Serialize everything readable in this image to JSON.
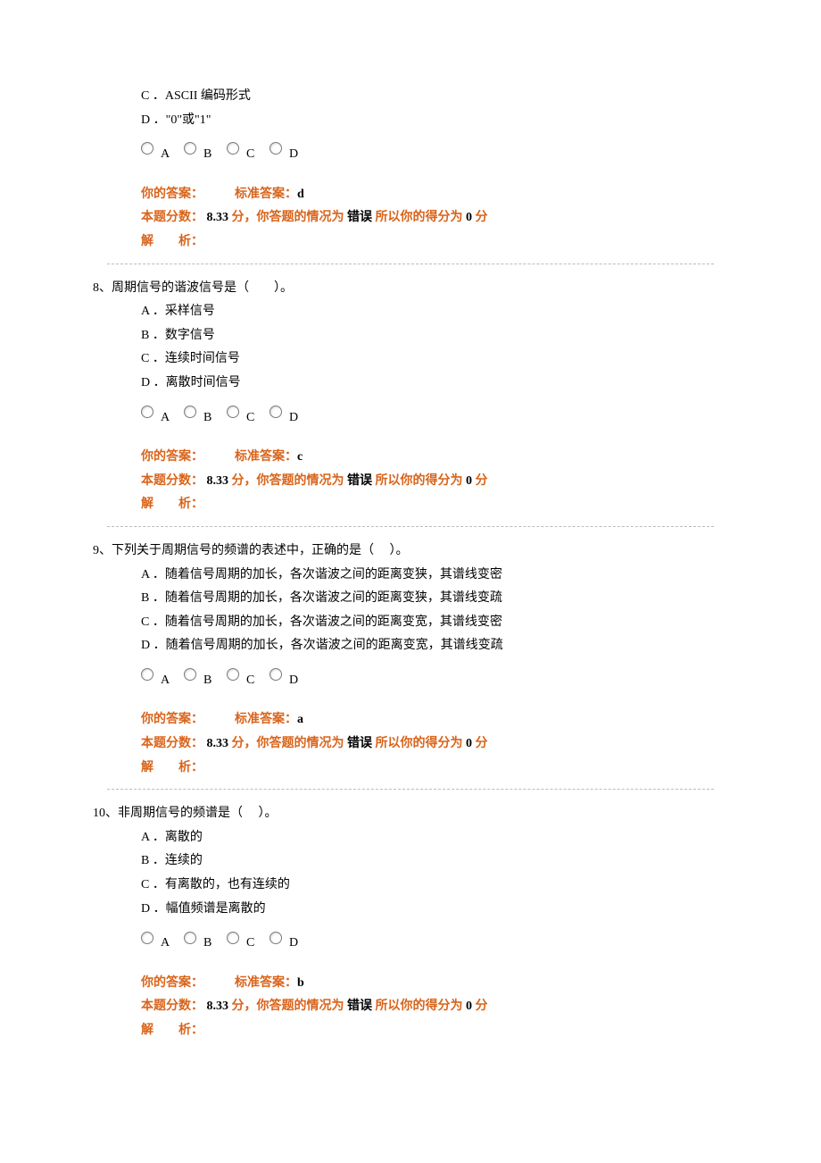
{
  "labels": {
    "your_answer_label": "你的答案：",
    "std_answer_label": "标准答案：",
    "score_prefix": "本题分数：",
    "score_unit": "分",
    "status_phrase_prefix": "，你答题的情况为",
    "so_score_prefix": "所以你的得分为",
    "explain_label": "解　　析："
  },
  "radio_letters": [
    "A",
    "B",
    "C",
    "D"
  ],
  "q7": {
    "options": [
      "C ．ASCII 编码形式",
      "D ．\"0\"或\"1\""
    ],
    "std_answer": "d",
    "score_value": "8.33",
    "status": "错误",
    "got": "0"
  },
  "q8": {
    "stem": "8、周期信号的谐波信号是（　　）。",
    "options": [
      "A ．采样信号",
      "B ．数字信号",
      "C ．连续时间信号",
      "D ．离散时间信号"
    ],
    "std_answer": "c",
    "score_value": "8.33",
    "status": "错误",
    "got": "0"
  },
  "q9": {
    "stem": "9、下列关于周期信号的频谱的表述中，正确的是（　 ）。",
    "options": [
      "A ．随着信号周期的加长，各次谐波之间的距离变狭，其谱线变密",
      "B ．随着信号周期的加长，各次谐波之间的距离变狭，其谱线变疏",
      "C ．随着信号周期的加长，各次谐波之间的距离变宽，其谱线变密",
      "D ．随着信号周期的加长，各次谐波之间的距离变宽，其谱线变疏"
    ],
    "std_answer": "a",
    "score_value": "8.33",
    "status": "错误",
    "got": "0"
  },
  "q10": {
    "stem": "10、非周期信号的频谱是（　 ）。",
    "options": [
      "A ．离散的",
      "B ．连续的",
      "C ．有离散的，也有连续的",
      "D ．幅值频谱是离散的"
    ],
    "std_answer": "b",
    "score_value": "8.33",
    "status": "错误",
    "got": "0"
  }
}
